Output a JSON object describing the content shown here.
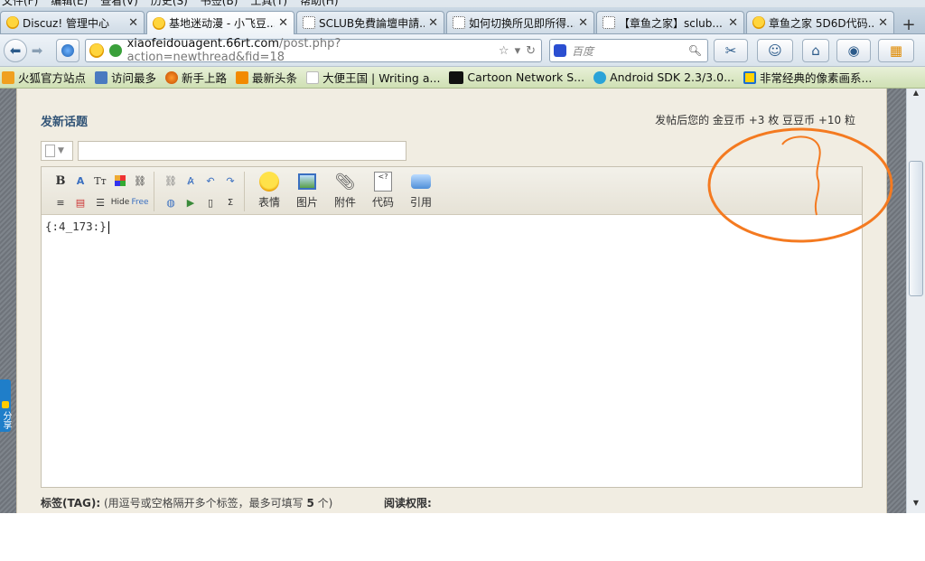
{
  "menu": [
    "文件(F)",
    "编辑(E)",
    "查看(V)",
    "历史(S)",
    "书签(B)",
    "工具(T)",
    "帮助(H)"
  ],
  "tabs": [
    {
      "title": "Discuz! 管理中心",
      "favicon": "emoticon-icon"
    },
    {
      "title": "基地迷动漫 - 小飞豆...",
      "favicon": "emoticon-icon",
      "active": true
    },
    {
      "title": "SCLUB免費論壇申請...",
      "favicon": "dotted-page-icon"
    },
    {
      "title": "如何切换所见即所得...",
      "favicon": "dotted-page-icon"
    },
    {
      "title": "【章鱼之家】sclub...",
      "favicon": "dotted-page-icon"
    },
    {
      "title": "章鱼之家 5D6D代码...",
      "favicon": "emoticon-icon"
    }
  ],
  "nav": {
    "url_host": "xiaofeidouagent.66rt.com",
    "url_path": "/post.php?action=newthread&fid=18",
    "search_placeholder": "百度"
  },
  "bookmarks": [
    "火狐官方站点",
    "访问最多",
    "新手上路",
    "最新头条",
    "大便王国 | Writing a...",
    "Cartoon Network S...",
    "Android SDK 2.3/3.0...",
    "非常经典的像素画系..."
  ],
  "form": {
    "title": "发新话题",
    "reward": "发帖后您的 金豆币 +3 枚  豆豆币 +10 粒",
    "editor_text": "{:4_173:}",
    "tag_label": "标签(TAG):",
    "tag_hint": "(用逗号或空格隔开多个标签，最多可填写 ",
    "tag_max": "5",
    "tag_hint_end": " 个)",
    "read_permission": "阅读权限:"
  },
  "toolbar": {
    "hide_label": "Hide",
    "free_label": "Free",
    "emoji_label": "表情",
    "image_label": "图片",
    "attach_label": "附件",
    "code_label": "代码",
    "quote_label": "引用"
  },
  "share_label": "分享",
  "colors": {
    "annotation": "#f47a20",
    "title_blue": "#335577",
    "share_blue": "#1f7ec9"
  }
}
